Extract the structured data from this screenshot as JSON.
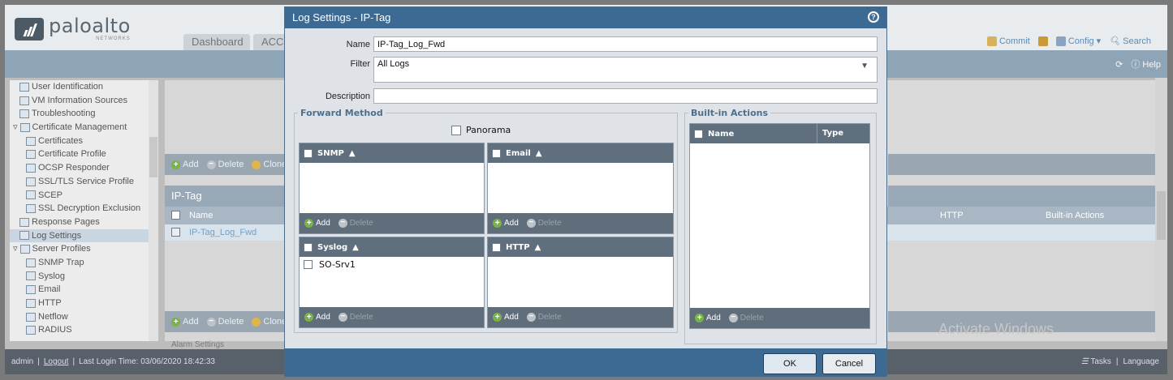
{
  "brand": {
    "name": "paloalto",
    "tagline": "NETWORKS"
  },
  "tabs": [
    "Dashboard",
    "ACC"
  ],
  "topbar": {
    "commit": "Commit",
    "config": "Config",
    "search": "Search",
    "help": "Help"
  },
  "tree": [
    {
      "label": "User Identification",
      "indent": 1
    },
    {
      "label": "VM Information Sources",
      "indent": 1
    },
    {
      "label": "Troubleshooting",
      "indent": 1
    },
    {
      "label": "Certificate Management",
      "indent": 0
    },
    {
      "label": "Certificates",
      "indent": 2
    },
    {
      "label": "Certificate Profile",
      "indent": 2
    },
    {
      "label": "OCSP Responder",
      "indent": 2
    },
    {
      "label": "SSL/TLS Service Profile",
      "indent": 2
    },
    {
      "label": "SCEP",
      "indent": 2
    },
    {
      "label": "SSL Decryption Exclusion",
      "indent": 2
    },
    {
      "label": "Response Pages",
      "indent": 1
    },
    {
      "label": "Log Settings",
      "indent": 1,
      "selected": true
    },
    {
      "label": "Server Profiles",
      "indent": 0
    },
    {
      "label": "SNMP Trap",
      "indent": 2
    },
    {
      "label": "Syslog",
      "indent": 2
    },
    {
      "label": "Email",
      "indent": 2
    },
    {
      "label": "HTTP",
      "indent": 2
    },
    {
      "label": "Netflow",
      "indent": 2
    },
    {
      "label": "RADIUS",
      "indent": 2
    }
  ],
  "main": {
    "toolbar": {
      "add": "Add",
      "delete": "Delete",
      "clone": "Clone"
    },
    "iptag_title": "IP-Tag",
    "columns": {
      "name": "Name",
      "http": "HTTP",
      "builtin": "Built-in Actions"
    },
    "row_name": "IP-Tag_Log_Fwd",
    "alarm": "Alarm Settings"
  },
  "watermark": "Activate Windows",
  "footer": {
    "user": "admin",
    "logout": "Logout",
    "last_login": "Last Login Time: 03/06/2020 18:42:33",
    "tasks": "Tasks",
    "language": "Language"
  },
  "modal": {
    "title": "Log Settings - IP-Tag",
    "name_label": "Name",
    "name_value": "IP-Tag_Log_Fwd",
    "filter_label": "Filter",
    "filter_value": "All Logs",
    "description_label": "Description",
    "description_value": "",
    "forward_method": "Forward Method",
    "panorama": "Panorama",
    "builtin_actions": "Built-in Actions",
    "builtin_cols": {
      "name": "Name",
      "type": "Type"
    },
    "grids": {
      "snmp": "SNMP",
      "email": "Email",
      "syslog": "Syslog",
      "http": "HTTP"
    },
    "syslog_row": "SO-Srv1",
    "add": "Add",
    "delete": "Delete",
    "ok": "OK",
    "cancel": "Cancel"
  }
}
